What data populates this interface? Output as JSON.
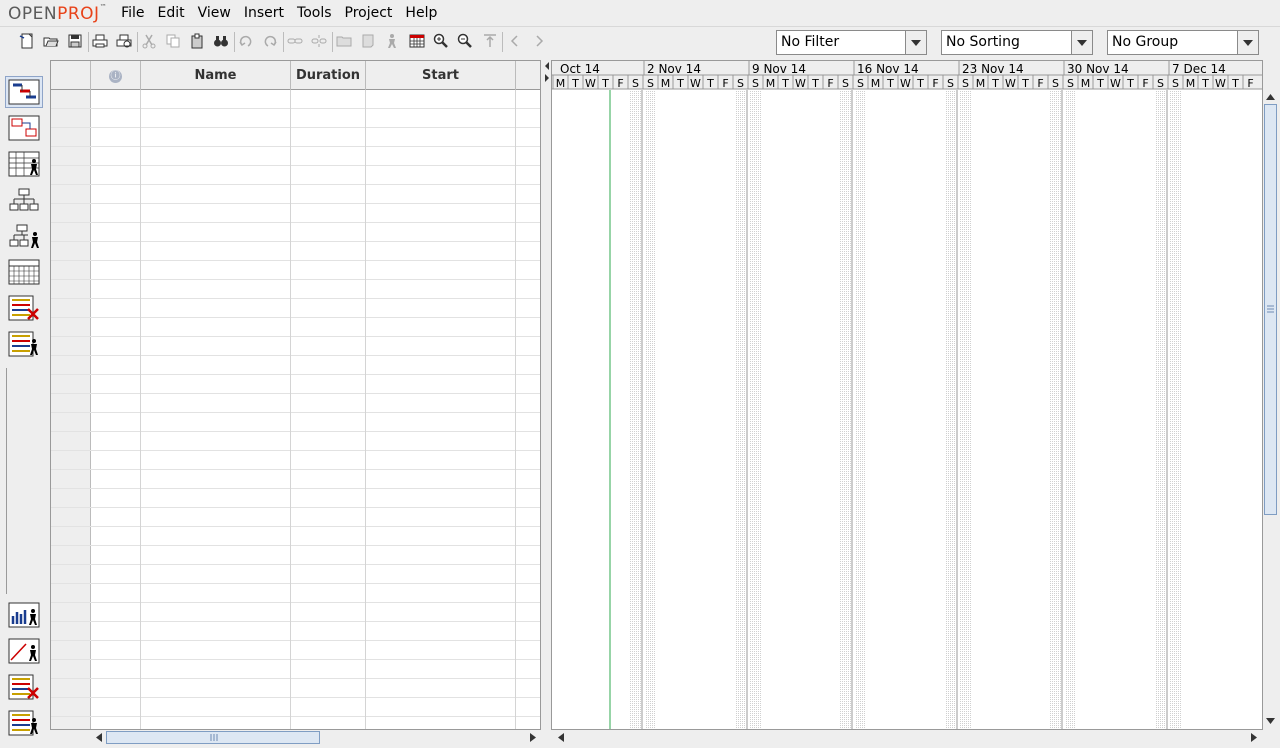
{
  "app": {
    "logo_open": "OPEN",
    "logo_proj": "PROJ",
    "logo_tm": "™"
  },
  "menu": {
    "file": "File",
    "edit": "Edit",
    "view": "View",
    "insert": "Insert",
    "tools": "Tools",
    "project": "Project",
    "help": "Help"
  },
  "toolbar": {
    "filter": "No Filter",
    "sorting": "No Sorting",
    "group": "No Group"
  },
  "table": {
    "columns": {
      "indicator": "ⓘ",
      "name": "Name",
      "duration": "Duration",
      "start": "Start"
    }
  },
  "gantt": {
    "weeks": [
      "Oct 14",
      "2 Nov 14",
      "9 Nov 14",
      "16 Nov 14",
      "23 Nov 14",
      "30 Nov 14",
      "7 Dec 14"
    ],
    "days": [
      "M",
      "T",
      "W",
      "T",
      "F",
      "S",
      "S",
      "M",
      "T",
      "W",
      "T",
      "F",
      "S",
      "S",
      "M",
      "T",
      "W",
      "T",
      "F",
      "S",
      "S",
      "M",
      "T",
      "W",
      "T",
      "F",
      "S",
      "S",
      "M",
      "T",
      "W",
      "T",
      "F",
      "S",
      "S",
      "M",
      "T",
      "W",
      "T",
      "F",
      "S",
      "S",
      "M",
      "T",
      "W",
      "T",
      "F"
    ]
  },
  "icons": {
    "view_bar": [
      "gantt-icon",
      "network-icon",
      "resource-sheet-icon",
      "wbs-icon",
      "rbs-icon",
      "project-sheet-icon",
      "task-usage-icon",
      "resource-usage-icon"
    ],
    "view_bar_bottom": [
      "histogram-icon",
      "charts-icon",
      "task-usage-detail-icon",
      "resource-usage-detail-icon"
    ]
  }
}
